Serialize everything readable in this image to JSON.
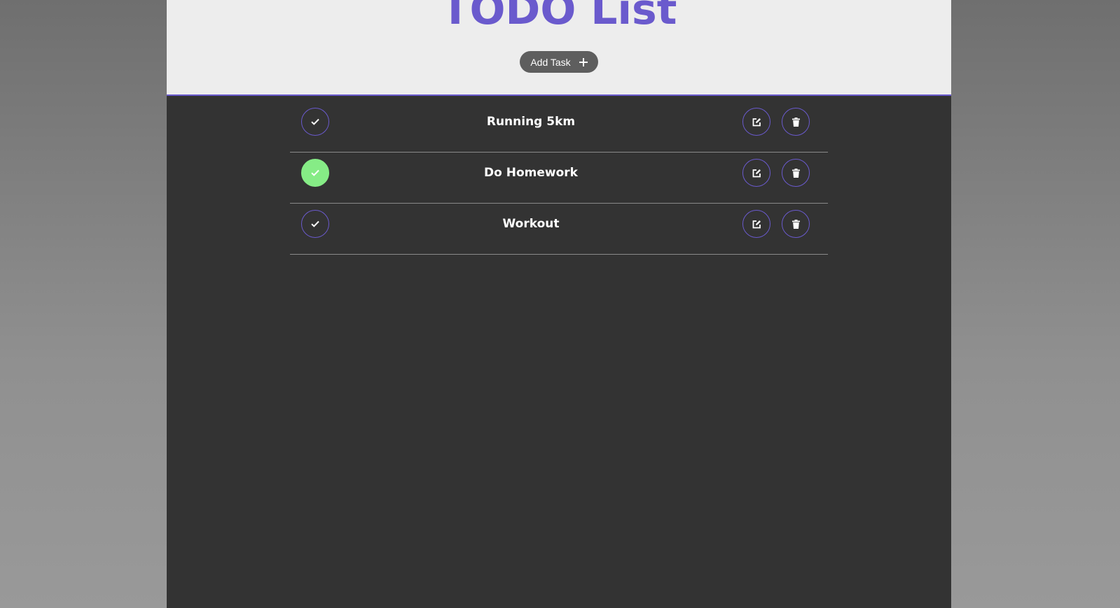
{
  "header": {
    "title": "TODO List",
    "add_button_label": "Add Task"
  },
  "tasks": [
    {
      "label": "Running 5km",
      "completed": false
    },
    {
      "label": "Do Homework",
      "completed": true
    },
    {
      "label": "Workout",
      "completed": false
    }
  ],
  "icons": {
    "complete": "check-icon",
    "edit": "edit-icon",
    "delete": "trash-icon",
    "add": "plus-icon"
  },
  "colors": {
    "accent": "#6a5acd",
    "completed": "#86ec86",
    "list_background": "#333333",
    "header_background": "#ededed"
  }
}
